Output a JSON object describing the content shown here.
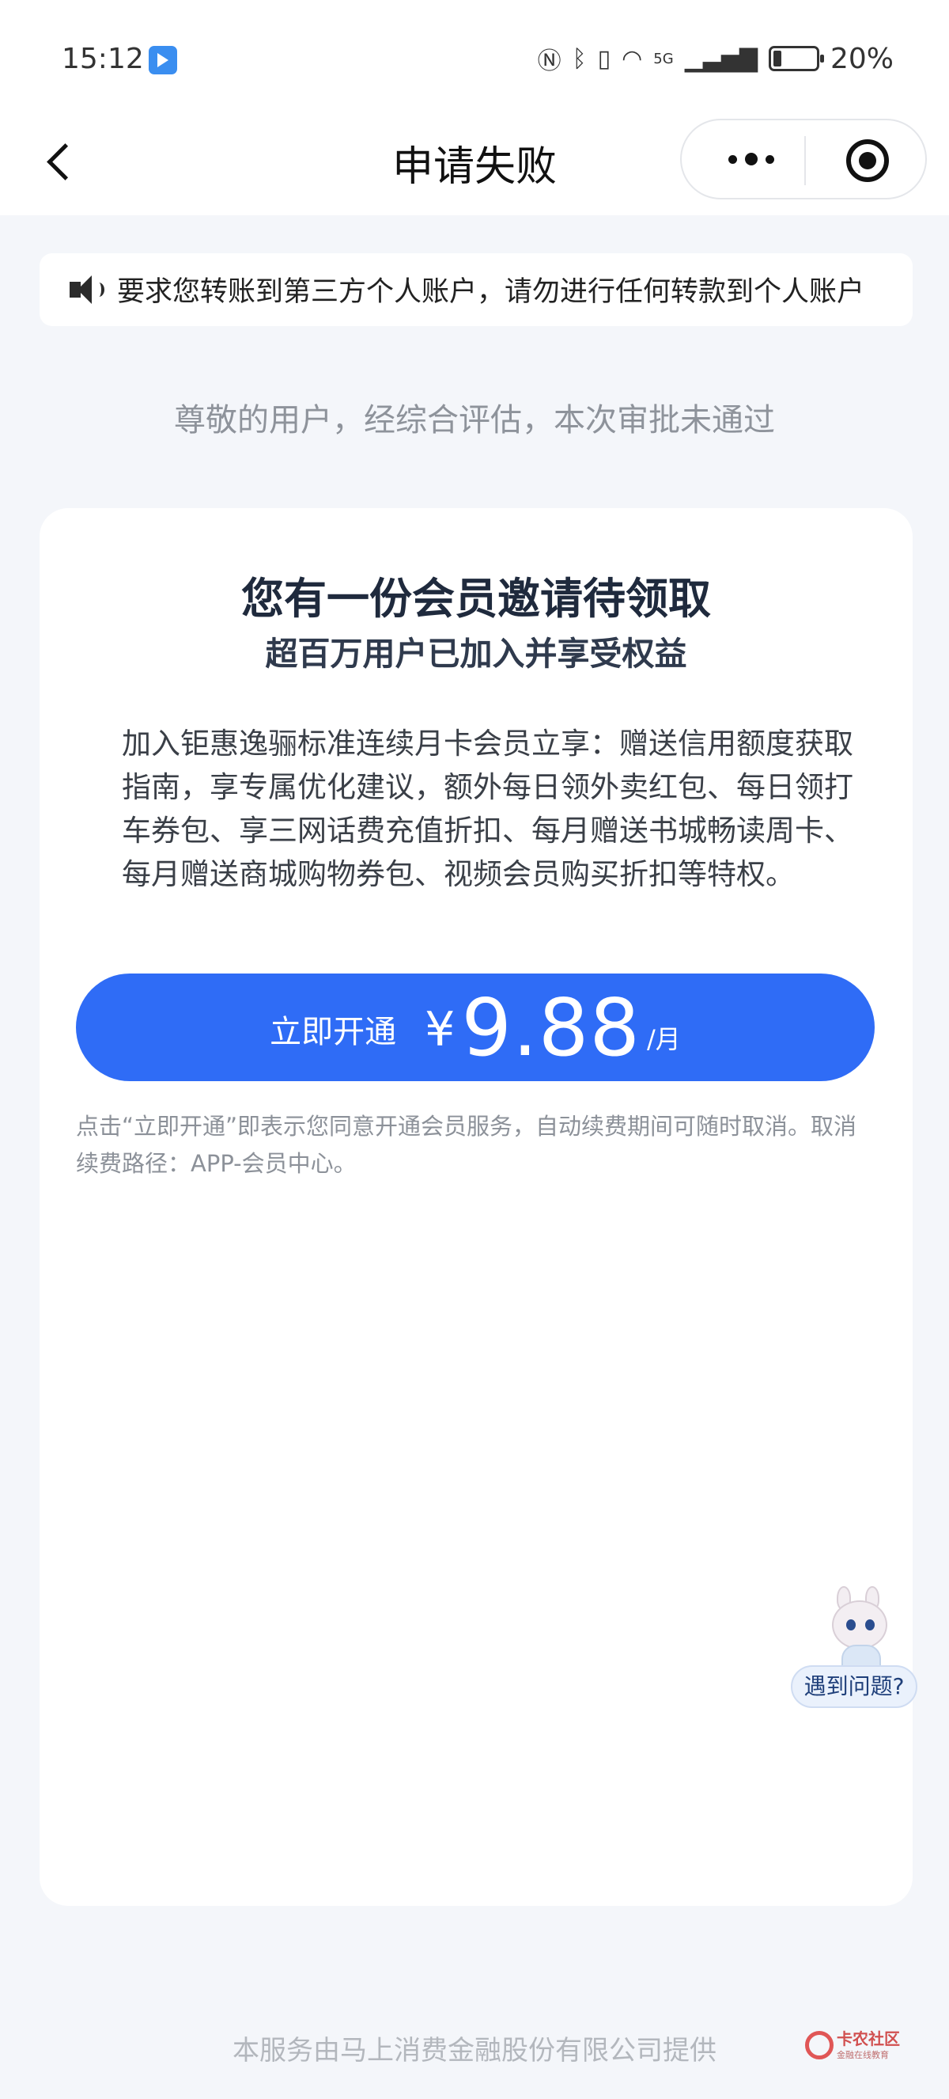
{
  "status_bar": {
    "time": "15:12",
    "icons": [
      "nfc-icon",
      "bluetooth-icon",
      "vibrate-icon",
      "wifi-icon",
      "signal-5g-icon",
      "battery-icon"
    ],
    "network_label": "5G",
    "battery_percent": "20%",
    "battery_level": 0.2
  },
  "nav": {
    "title": "申请失败",
    "back_icon": "chevron-left-icon",
    "more_icon": "more-dots-icon",
    "close_icon": "target-close-icon"
  },
  "notice": {
    "icon": "speaker-icon",
    "text": "要求您转账到第三方个人账户，请勿进行任何转款到个人账户"
  },
  "subtitle": "尊敬的用户，经综合评估，本次审批未通过",
  "card": {
    "title": "您有一份会员邀请待领取",
    "subtitle": "超百万用户已加入并享受权益",
    "description": "加入钜惠逸骊标准连续月卡会员立享：赠送信用额度获取指南，享专属优化建议，额外每日领外卖红包、每日领打车券包、享三网话费充值折扣、每月赠送书城畅读周卡、每月赠送商城购物券包、视频会员购买折扣等特权。",
    "button": {
      "label": "立即开通",
      "currency": "¥",
      "price": "9.88",
      "unit": "/月",
      "color": "#2f6cf6"
    },
    "agreement": "点击“立即开通”即表示您同意开通会员服务，自动续费期间可随时取消。取消续费路径：APP-会员中心。"
  },
  "help": {
    "label": "遇到问题?"
  },
  "footer": "本服务由马上消费金融股份有限公司提供",
  "watermark": {
    "title": "卡农社区",
    "subtitle": "金融在线教育"
  }
}
